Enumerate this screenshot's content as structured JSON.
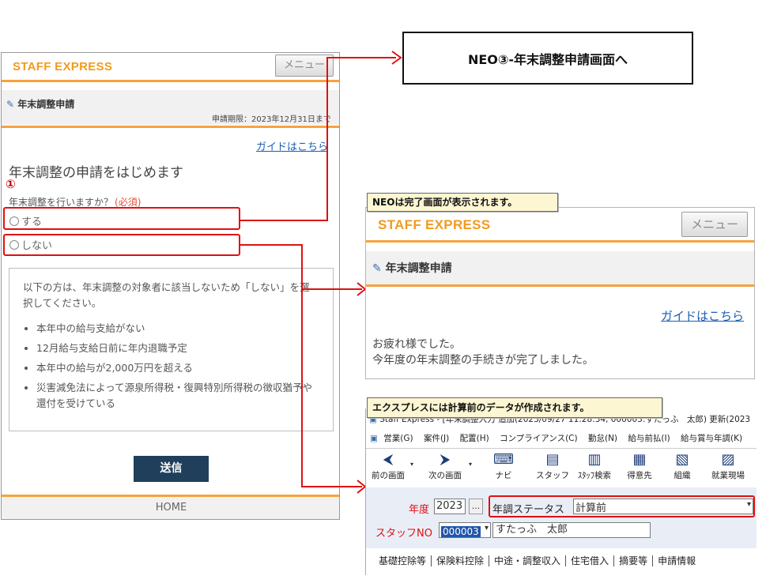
{
  "neo_button_label": "NEO③-年末調整申請画面へ",
  "left": {
    "brand": "STAFF EXPRESS",
    "menu_label": "メニュー",
    "page_title": "年末調整申請",
    "deadline": "申請期限：2023年12月31日まで",
    "guide_link": "ガイドはこちら",
    "heading": "年末調整の申請をはじめます",
    "step_marker": "①",
    "question": "年末調整を行いますか？",
    "required": "(必須)",
    "option_yes": "する",
    "option_no": "しない",
    "info_intro": "以下の方は、年末調整の対象者に該当しないため「しない」を選択してください。",
    "info_items": [
      "本年中の給与支給がない",
      "12月給与支給日前に年内退職予定",
      "本年中の給与が2,000万円を超える",
      "災害減免法によって源泉所得税・復興特別所得税の徴収猶予や還付を受けている"
    ],
    "submit_label": "送信",
    "home_label": "HOME"
  },
  "right_top": {
    "callout": "NEOは完了画面が表示されます。",
    "brand": "STAFF EXPRESS",
    "menu_label": "メニュー",
    "page_title": "年末調整申請",
    "guide_link": "ガイドはこちら",
    "done_line1": "お疲れ様でした。",
    "done_line2": "今年度の年末調整の手続きが完了しました。"
  },
  "right_bottom": {
    "callout": "エクスプレスには計算前のデータが作成されます。",
    "titlebar": "Staff Express - [年末調整入力 追加(2023/09/27 11:28:34, 000003:すたっふ　太郎) 更新(2023",
    "menu_items": [
      "営業(G)",
      "案件(J)",
      "配置(H)",
      "コンプライアンス(C)",
      "勤怠(N)",
      "給与前払(I)",
      "給与賞与年調(K)"
    ],
    "toolbar": [
      {
        "label": "前の画面",
        "icon": "back-arrow-icon"
      },
      {
        "label": "次の画面",
        "icon": "forward-arrow-icon"
      },
      {
        "label": "ナビ",
        "icon": "keyboard-icon"
      },
      {
        "label": "スタッフ",
        "icon": "staff-icon"
      },
      {
        "label": "ｽﾀｯﾌ検索",
        "icon": "staff-search-icon"
      },
      {
        "label": "得意先",
        "icon": "client-icon"
      },
      {
        "label": "組織",
        "icon": "organization-icon"
      },
      {
        "label": "就業現場",
        "icon": "worksite-icon"
      }
    ],
    "year_label": "年度",
    "year_value": "2023",
    "ellipsis_button": "...",
    "status_label": "年調ステータス",
    "status_value": "計算前",
    "staff_no_label": "スタッフNO",
    "staff_no_value": "000003",
    "staff_name": "すたっふ　太郎",
    "tabs": [
      "基礎控除等",
      "保険料控除",
      "中途・調整収入",
      "住宅借入",
      "摘要等",
      "申請情報"
    ]
  },
  "colors": {
    "accent_orange": "#f39a1e",
    "highlight_red": "#e01010",
    "submit_navy": "#1f3f5b",
    "callout_yellow": "#fdf6d3"
  }
}
